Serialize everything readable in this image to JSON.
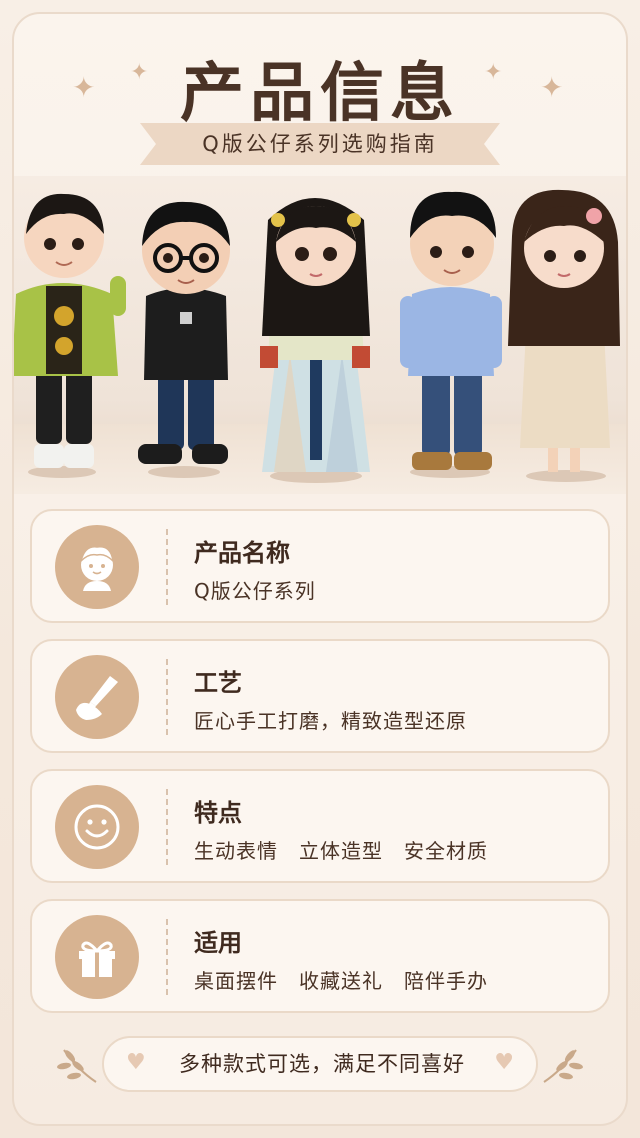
{
  "header": {
    "title": "产品信息",
    "subtitle": "Q版公仔系列选购指南"
  },
  "hero": {
    "figures": [
      "绿衣男孩",
      "眼镜男孩",
      "汉服女孩",
      "蓝衬衫男孩",
      "长发女孩"
    ]
  },
  "cards": [
    {
      "icon": "child-face-icon",
      "heading": "产品名称",
      "desc": "Q版公仔系列"
    },
    {
      "icon": "hand-brush-icon",
      "heading": "工艺",
      "desc": "匠心手工打磨，精致造型还原"
    },
    {
      "icon": "smiley-icon",
      "heading": "特点",
      "desc": "生动表情　立体造型　安全材质"
    },
    {
      "icon": "gift-icon",
      "heading": "适用",
      "desc": "桌面摆件　收藏送礼　陪伴手办"
    }
  ],
  "footer": {
    "text": "多种款式可选，满足不同喜好"
  },
  "colors": {
    "background": "#f4e8dc",
    "accent": "#d7b391",
    "text": "#4a3326"
  }
}
